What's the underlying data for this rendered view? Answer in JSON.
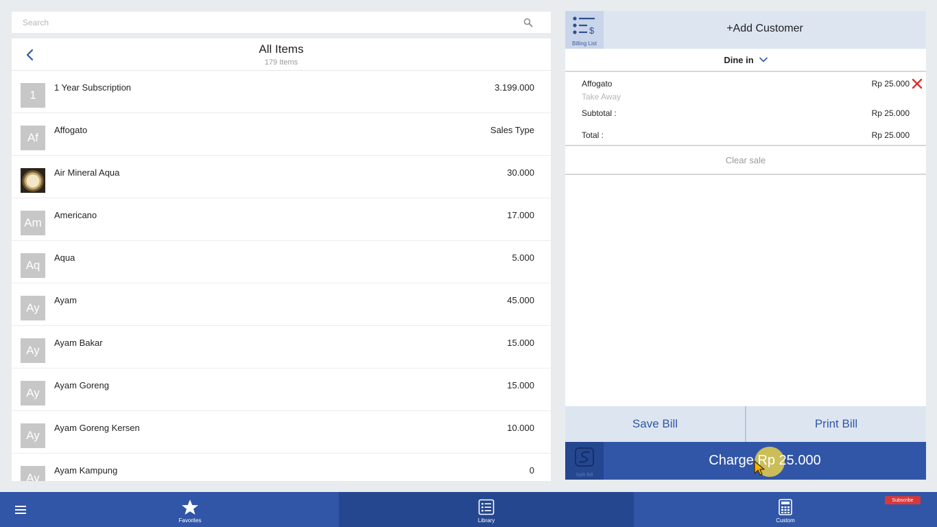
{
  "search": {
    "placeholder": "Search"
  },
  "items_panel": {
    "title": "All Items",
    "count": "179 Items",
    "items": [
      {
        "initials": "1",
        "name": "1 Year Subscription",
        "price": "3.199.000",
        "thumb": "initials"
      },
      {
        "initials": "Af",
        "name": "Affogato",
        "price": "Sales Type",
        "thumb": "initials"
      },
      {
        "initials": "",
        "name": "Air Mineral Aqua",
        "price": "30.000",
        "thumb": "photo"
      },
      {
        "initials": "Am",
        "name": "Americano",
        "price": "17.000",
        "thumb": "initials"
      },
      {
        "initials": "Aq",
        "name": "Aqua",
        "price": "5.000",
        "thumb": "initials"
      },
      {
        "initials": "Ay",
        "name": "Ayam",
        "price": "45.000",
        "thumb": "initials"
      },
      {
        "initials": "Ay",
        "name": "Ayam Bakar",
        "price": "15.000",
        "thumb": "initials"
      },
      {
        "initials": "Ay",
        "name": "Ayam Goreng",
        "price": "15.000",
        "thumb": "initials"
      },
      {
        "initials": "Ay",
        "name": "Ayam Goreng Kersen",
        "price": "10.000",
        "thumb": "initials"
      },
      {
        "initials": "Ay",
        "name": "Ayam Kampung",
        "price": "0",
        "thumb": "initials"
      }
    ]
  },
  "bill": {
    "billing_list_label": "Billing List",
    "add_customer": "+Add Customer",
    "dine_option": "Dine in",
    "order_item": {
      "name": "Affogato",
      "sales_type": "Take Away",
      "price": "Rp 25.000"
    },
    "subtotal_label": "Subtotal :",
    "subtotal_value": "Rp 25.000",
    "total_label": "Total :",
    "total_value": "Rp 25.000",
    "clear_sale": "Clear sale",
    "save_bill": "Save Bill",
    "print_bill": "Print Bill",
    "split_bill_label": "Split Bill",
    "charge": "Charge Rp 25.000"
  },
  "nav": {
    "favorites": "Favorites",
    "library": "Library",
    "custom": "Custom",
    "subscribe": "Subscribe"
  },
  "colors": {
    "primary": "#3156a8",
    "primary_dark": "#24478f",
    "panel_tint": "#dde5f1",
    "remove": "#e02b2b",
    "background": "#e8ecef"
  }
}
